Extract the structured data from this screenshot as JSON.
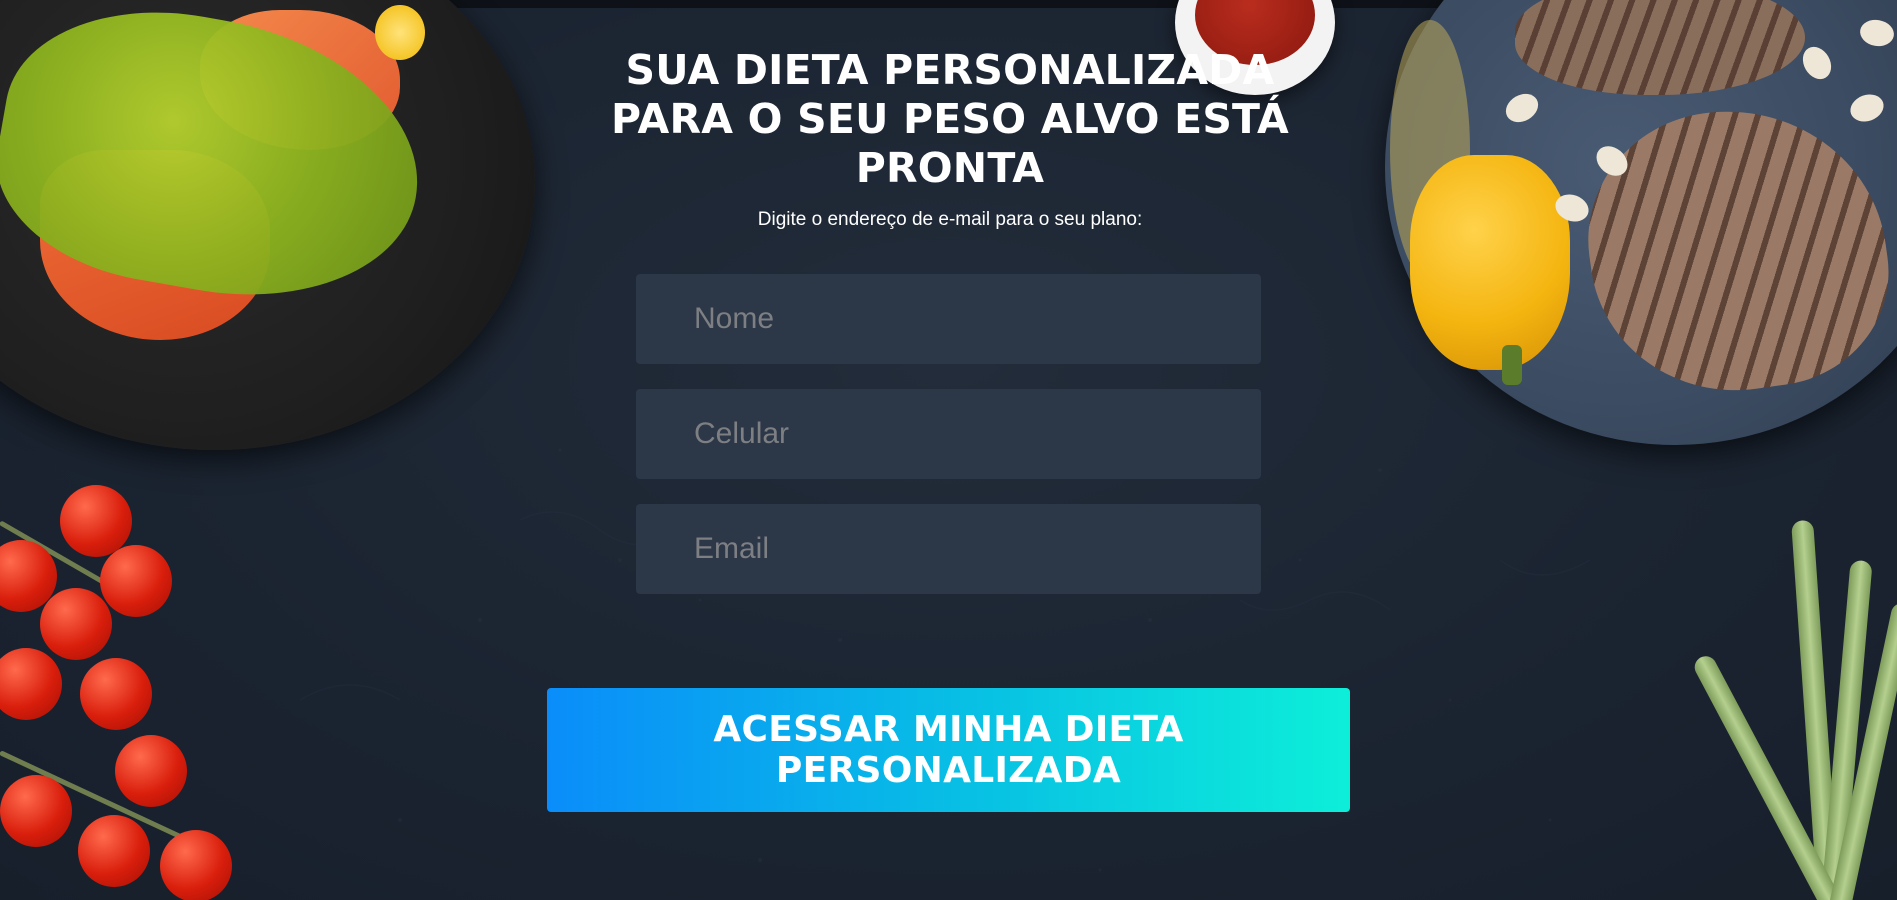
{
  "header": {
    "headline": "SUA DIETA PERSONALIZADA PARA O SEU PESO ALVO ESTÁ PRONTA",
    "subtitle": "Digite o endereço de e-mail para o seu plano:"
  },
  "form": {
    "name_placeholder": "Nome",
    "phone_placeholder": "Celular",
    "email_placeholder": "Email",
    "submit_label": "ACESSAR MINHA DIETA PERSONALIZADA"
  },
  "colors": {
    "background": "#1b2431",
    "field_background": "#2c3748",
    "button_gradient_start": "#0a8dfa",
    "button_gradient_end": "#0deed9",
    "text": "#ffffff"
  },
  "decor": {
    "images": [
      "salmon-guacamole-plate-image",
      "ketchup-bowl-image",
      "grilled-steak-board-image",
      "cherry-tomatoes-image",
      "asparagus-image"
    ]
  }
}
